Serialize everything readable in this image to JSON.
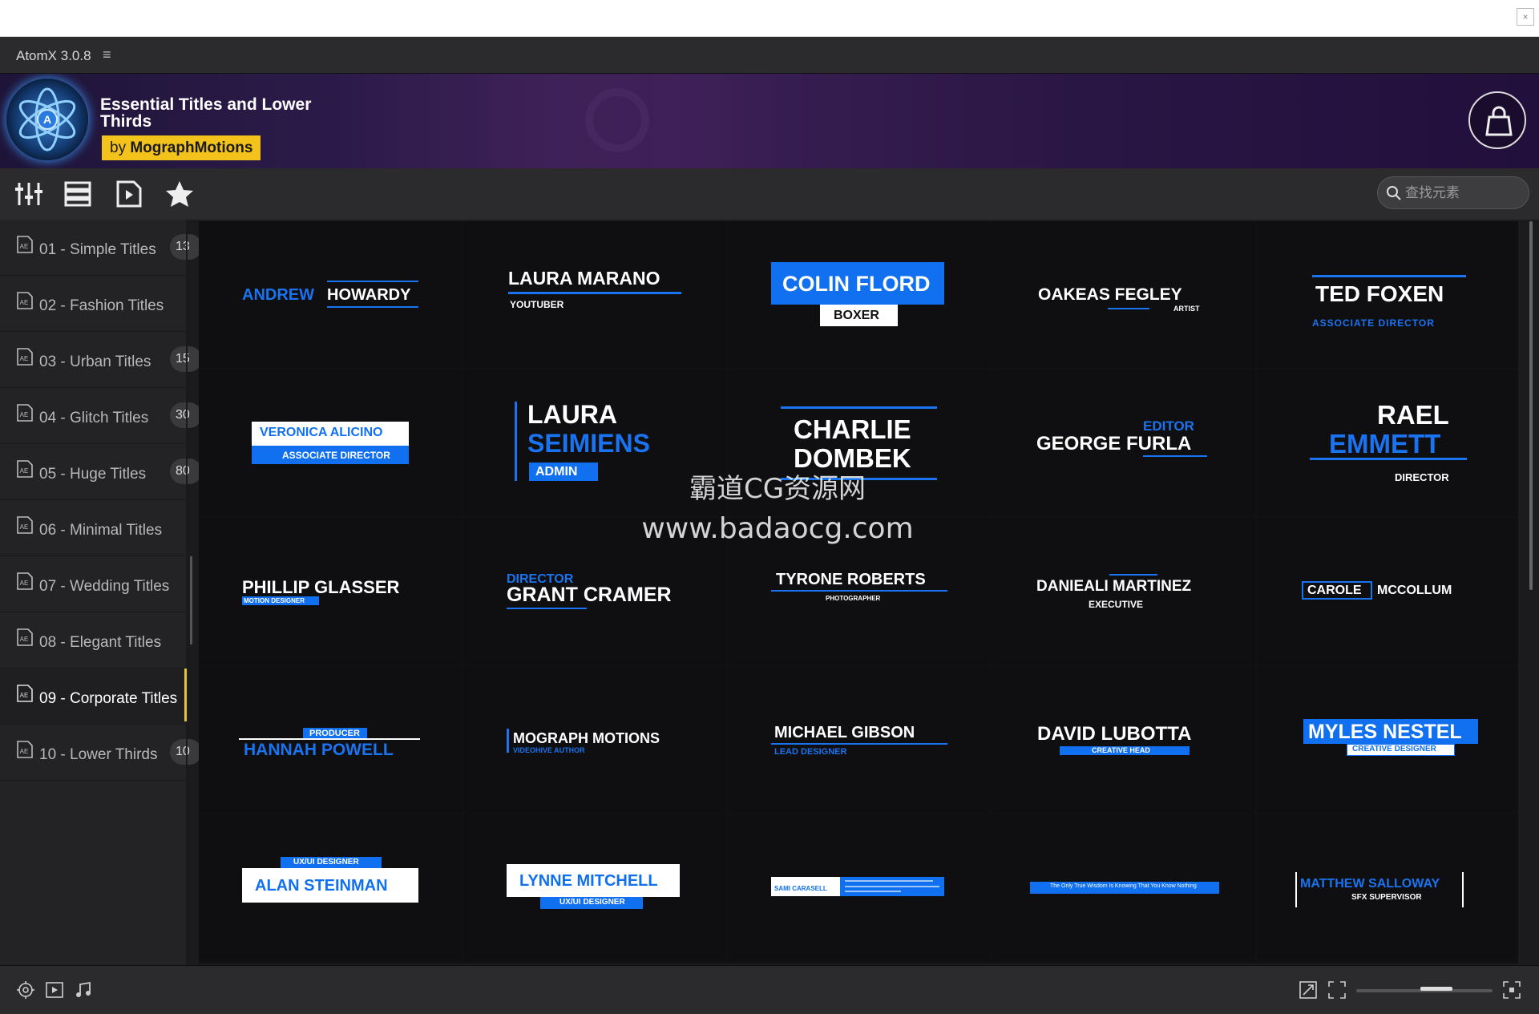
{
  "window": {
    "close_symbol": "×"
  },
  "titlebar": {
    "app_name": "AtomX 3.0.8",
    "menu_symbol": "≡"
  },
  "banner": {
    "pack_title": "Essential Titles and Lower Thirds",
    "author_prefix": "by ",
    "author_name": "MographMotions"
  },
  "toolbar": {
    "buttons": [
      "sliders-icon",
      "list-view-icon",
      "play-file-icon",
      "star-icon"
    ],
    "search_placeholder": "查找元素"
  },
  "sidebar": {
    "items": [
      {
        "label": "01 - Simple Titles",
        "count": "13"
      },
      {
        "label": "02 - Fashion Titles",
        "count": ""
      },
      {
        "label": "03 - Urban Titles",
        "count": "15"
      },
      {
        "label": "04 - Glitch Titles",
        "count": "30"
      },
      {
        "label": "05 - Huge Titles",
        "count": "80"
      },
      {
        "label": "06 - Minimal Titles",
        "count": ""
      },
      {
        "label": "07 - Wedding Titles",
        "count": ""
      },
      {
        "label": "08 - Elegant Titles",
        "count": ""
      },
      {
        "label": "09 - Corporate Titles",
        "count": ""
      },
      {
        "label": "10 - Lower Thirds",
        "count": "10"
      }
    ],
    "active_index": 8
  },
  "grid": {
    "tiles": [
      {
        "a": "ANDREW",
        "b": "HOWARDY"
      },
      {
        "a": "LAURA MARANO",
        "b": "YOUTUBER"
      },
      {
        "a": "COLIN FLORD",
        "b": "BOXER"
      },
      {
        "a": "OAKEAS FEGLEY",
        "b": "ARTIST"
      },
      {
        "a": "TED FOXEN",
        "b": "ASSOCIATE DIRECTOR"
      },
      {
        "a": "VERONICA ALICINO",
        "b": "ASSOCIATE DIRECTOR"
      },
      {
        "a": "LAURA",
        "b": "SEIMIENS",
        "c": "ADMIN"
      },
      {
        "a": "CHARLIE",
        "b": "DOMBEK"
      },
      {
        "a": "EDITOR",
        "b": "GEORGE FURLA"
      },
      {
        "a": "RAEL",
        "b": "EMMETT",
        "c": "DIRECTOR"
      },
      {
        "a": "PHILLIP GLASSER",
        "b": "MOTION DESIGNER"
      },
      {
        "a": "DIRECTOR",
        "b": "GRANT CRAMER"
      },
      {
        "a": "TYRONE ROBERTS",
        "b": "PHOTOGRAPHER"
      },
      {
        "a": "DANIEALI MARTINEZ",
        "b": "EXECUTIVE"
      },
      {
        "a": "CAROLE",
        "b": "MCCOLLUM"
      },
      {
        "a": "PRODUCER",
        "b": "HANNAH POWELL"
      },
      {
        "a": "MOGRAPH MOTIONS",
        "b": "VIDEOHIVE AUTHOR"
      },
      {
        "a": "MICHAEL GIBSON",
        "b": "LEAD DESIGNER"
      },
      {
        "a": "DAVID LUBOTTA",
        "b": "CREATIVE HEAD"
      },
      {
        "a": "MYLES NESTEL",
        "b": "CREATIVE DESIGNER"
      },
      {
        "a": "UX/UI DESIGNER",
        "b": "ALAN STEINMAN"
      },
      {
        "a": "LYNNE MITCHELL",
        "b": "UX/UI DESIGNER"
      },
      {
        "a": "SAMI CARASELL",
        "b": ""
      },
      {
        "a": "The Only True Wisdom Is Knowing That You Know Nothing",
        "b": ""
      },
      {
        "a": "MATTHEW SALLOWAY",
        "b": "SFX SUPERVISOR"
      }
    ]
  },
  "watermark": {
    "line1": "霸道CG资源网",
    "line2": "www.badaocg.com"
  },
  "colors": {
    "accent_blue": "#1170f0",
    "brand_yellow": "#f3c21b",
    "active_marker": "#e7c532"
  }
}
